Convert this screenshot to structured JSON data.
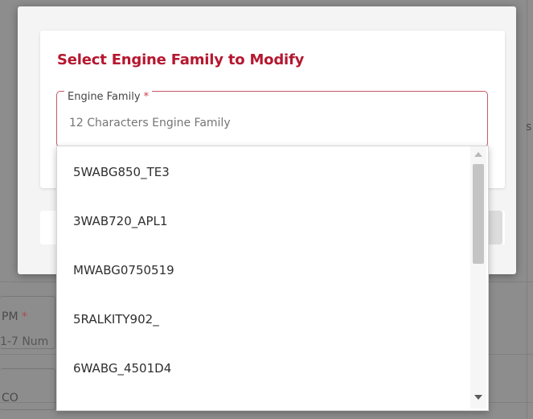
{
  "dialog": {
    "title": "Select Engine Family to Modify",
    "field": {
      "label": "Engine Family",
      "required_mark": "*",
      "placeholder": "12 Characters Engine Family",
      "value": ""
    },
    "accent_color": "#b5172f"
  },
  "dropdown": {
    "options": [
      "5WABG850_TE3",
      "3WAB720_APL1",
      "MWABG0750519",
      "5RALKITY902_",
      "6WABG_4501D4"
    ]
  },
  "background": {
    "label_fragment": "PM",
    "required_mark": "*",
    "placeholder_fragment": "1-7 Num",
    "label_fragment_2": "CO",
    "edge_glyph": "s"
  }
}
